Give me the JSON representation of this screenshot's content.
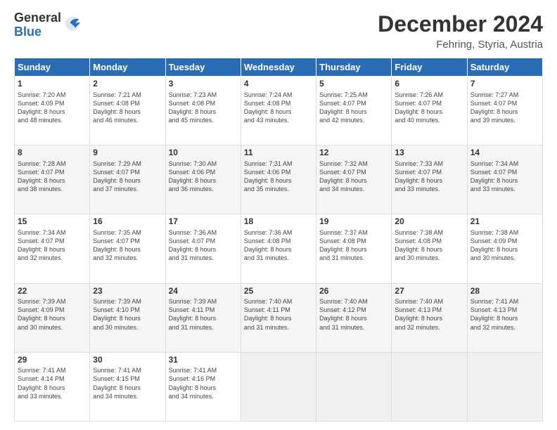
{
  "logo": {
    "general": "General",
    "blue": "Blue"
  },
  "header": {
    "month": "December 2024",
    "location": "Fehring, Styria, Austria"
  },
  "weekdays": [
    "Sunday",
    "Monday",
    "Tuesday",
    "Wednesday",
    "Thursday",
    "Friday",
    "Saturday"
  ],
  "weeks": [
    [
      {
        "day": 1,
        "lines": [
          "Sunrise: 7:20 AM",
          "Sunset: 4:09 PM",
          "Daylight: 8 hours",
          "and 48 minutes."
        ]
      },
      {
        "day": 2,
        "lines": [
          "Sunrise: 7:21 AM",
          "Sunset: 4:08 PM",
          "Daylight: 8 hours",
          "and 46 minutes."
        ]
      },
      {
        "day": 3,
        "lines": [
          "Sunrise: 7:23 AM",
          "Sunset: 4:08 PM",
          "Daylight: 8 hours",
          "and 45 minutes."
        ]
      },
      {
        "day": 4,
        "lines": [
          "Sunrise: 7:24 AM",
          "Sunset: 4:08 PM",
          "Daylight: 8 hours",
          "and 43 minutes."
        ]
      },
      {
        "day": 5,
        "lines": [
          "Sunrise: 7:25 AM",
          "Sunset: 4:07 PM",
          "Daylight: 8 hours",
          "and 42 minutes."
        ]
      },
      {
        "day": 6,
        "lines": [
          "Sunrise: 7:26 AM",
          "Sunset: 4:07 PM",
          "Daylight: 8 hours",
          "and 40 minutes."
        ]
      },
      {
        "day": 7,
        "lines": [
          "Sunrise: 7:27 AM",
          "Sunset: 4:07 PM",
          "Daylight: 8 hours",
          "and 39 minutes."
        ]
      }
    ],
    [
      {
        "day": 8,
        "lines": [
          "Sunrise: 7:28 AM",
          "Sunset: 4:07 PM",
          "Daylight: 8 hours",
          "and 38 minutes."
        ]
      },
      {
        "day": 9,
        "lines": [
          "Sunrise: 7:29 AM",
          "Sunset: 4:07 PM",
          "Daylight: 8 hours",
          "and 37 minutes."
        ]
      },
      {
        "day": 10,
        "lines": [
          "Sunrise: 7:30 AM",
          "Sunset: 4:06 PM",
          "Daylight: 8 hours",
          "and 36 minutes."
        ]
      },
      {
        "day": 11,
        "lines": [
          "Sunrise: 7:31 AM",
          "Sunset: 4:06 PM",
          "Daylight: 8 hours",
          "and 35 minutes."
        ]
      },
      {
        "day": 12,
        "lines": [
          "Sunrise: 7:32 AM",
          "Sunset: 4:07 PM",
          "Daylight: 8 hours",
          "and 34 minutes."
        ]
      },
      {
        "day": 13,
        "lines": [
          "Sunrise: 7:33 AM",
          "Sunset: 4:07 PM",
          "Daylight: 8 hours",
          "and 33 minutes."
        ]
      },
      {
        "day": 14,
        "lines": [
          "Sunrise: 7:34 AM",
          "Sunset: 4:07 PM",
          "Daylight: 8 hours",
          "and 33 minutes."
        ]
      }
    ],
    [
      {
        "day": 15,
        "lines": [
          "Sunrise: 7:34 AM",
          "Sunset: 4:07 PM",
          "Daylight: 8 hours",
          "and 32 minutes."
        ]
      },
      {
        "day": 16,
        "lines": [
          "Sunrise: 7:35 AM",
          "Sunset: 4:07 PM",
          "Daylight: 8 hours",
          "and 32 minutes."
        ]
      },
      {
        "day": 17,
        "lines": [
          "Sunrise: 7:36 AM",
          "Sunset: 4:07 PM",
          "Daylight: 8 hours",
          "and 31 minutes."
        ]
      },
      {
        "day": 18,
        "lines": [
          "Sunrise: 7:36 AM",
          "Sunset: 4:08 PM",
          "Daylight: 8 hours",
          "and 31 minutes."
        ]
      },
      {
        "day": 19,
        "lines": [
          "Sunrise: 7:37 AM",
          "Sunset: 4:08 PM",
          "Daylight: 8 hours",
          "and 31 minutes."
        ]
      },
      {
        "day": 20,
        "lines": [
          "Sunrise: 7:38 AM",
          "Sunset: 4:08 PM",
          "Daylight: 8 hours",
          "and 30 minutes."
        ]
      },
      {
        "day": 21,
        "lines": [
          "Sunrise: 7:38 AM",
          "Sunset: 4:09 PM",
          "Daylight: 8 hours",
          "and 30 minutes."
        ]
      }
    ],
    [
      {
        "day": 22,
        "lines": [
          "Sunrise: 7:39 AM",
          "Sunset: 4:09 PM",
          "Daylight: 8 hours",
          "and 30 minutes."
        ]
      },
      {
        "day": 23,
        "lines": [
          "Sunrise: 7:39 AM",
          "Sunset: 4:10 PM",
          "Daylight: 8 hours",
          "and 30 minutes."
        ]
      },
      {
        "day": 24,
        "lines": [
          "Sunrise: 7:39 AM",
          "Sunset: 4:11 PM",
          "Daylight: 8 hours",
          "and 31 minutes."
        ]
      },
      {
        "day": 25,
        "lines": [
          "Sunrise: 7:40 AM",
          "Sunset: 4:11 PM",
          "Daylight: 8 hours",
          "and 31 minutes."
        ]
      },
      {
        "day": 26,
        "lines": [
          "Sunrise: 7:40 AM",
          "Sunset: 4:12 PM",
          "Daylight: 8 hours",
          "and 31 minutes."
        ]
      },
      {
        "day": 27,
        "lines": [
          "Sunrise: 7:40 AM",
          "Sunset: 4:13 PM",
          "Daylight: 8 hours",
          "and 32 minutes."
        ]
      },
      {
        "day": 28,
        "lines": [
          "Sunrise: 7:41 AM",
          "Sunset: 4:13 PM",
          "Daylight: 8 hours",
          "and 32 minutes."
        ]
      }
    ],
    [
      {
        "day": 29,
        "lines": [
          "Sunrise: 7:41 AM",
          "Sunset: 4:14 PM",
          "Daylight: 8 hours",
          "and 33 minutes."
        ]
      },
      {
        "day": 30,
        "lines": [
          "Sunrise: 7:41 AM",
          "Sunset: 4:15 PM",
          "Daylight: 8 hours",
          "and 34 minutes."
        ]
      },
      {
        "day": 31,
        "lines": [
          "Sunrise: 7:41 AM",
          "Sunset: 4:16 PM",
          "Daylight: 8 hours",
          "and 34 minutes."
        ]
      },
      null,
      null,
      null,
      null
    ]
  ]
}
